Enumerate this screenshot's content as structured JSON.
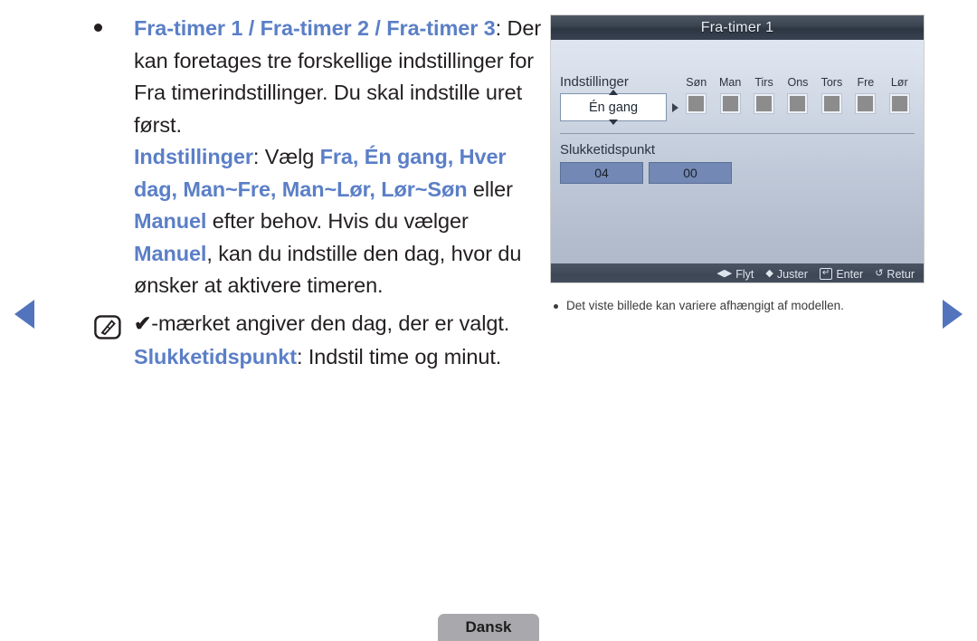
{
  "document": {
    "language_tab": "Dansk"
  },
  "navigation": {
    "prev_label": "previous-page",
    "next_label": "next-page"
  },
  "content": {
    "bullet_paragraph": {
      "term": "Fra-timer 1 / Fra-timer 2 / Fra-timer 3",
      "term_plain_tail": "3",
      "description": ": Der kan foretages tre forskellige indstillinger for Fra timerindstillinger. Du skal indstille uret først."
    },
    "settings_paragraph": {
      "label": "Indstillinger",
      "lead": ": Vælg ",
      "options": "Fra, Én gang, Hver dag, Man~Fre, Man~Lør, Lør~Søn",
      "mid": " eller ",
      "manual": "Manuel",
      "tail": " efter behov. Hvis du vælger ",
      "manual2": "Manuel",
      "tail2": ", kan du indstille den dag, hvor du ønsker at aktivere timeren."
    },
    "note": {
      "icon": "note-pen-icon",
      "check": "✔",
      "text": "-mærket angiver den dag, der er valgt."
    },
    "offtime_paragraph": {
      "label": "Slukketidspunkt",
      "text": ": Indstil time og minut."
    }
  },
  "tv_screen": {
    "title": "Fra-timer 1",
    "settings_label": "Indstillinger",
    "settings_value": "Én gang",
    "days": [
      {
        "name": "Søn",
        "checked": false
      },
      {
        "name": "Man",
        "checked": false
      },
      {
        "name": "Tirs",
        "checked": false
      },
      {
        "name": "Ons",
        "checked": false
      },
      {
        "name": "Tors",
        "checked": false
      },
      {
        "name": "Fre",
        "checked": false
      },
      {
        "name": "Lør",
        "checked": false
      }
    ],
    "offtime_label": "Slukketidspunkt",
    "hour_value": "04",
    "minute_value": "00",
    "status_bar": [
      {
        "glyph": "◀▶",
        "label": "Flyt",
        "icon": "left-right-arrows-icon"
      },
      {
        "glyph": "◆",
        "label": "Juster",
        "icon": "up-down-arrows-icon"
      },
      {
        "glyph": "↵",
        "label": "Enter",
        "icon": "enter-key-icon"
      },
      {
        "glyph": "↺",
        "label": "Retur",
        "icon": "return-arrow-icon"
      }
    ]
  },
  "tv_caption": {
    "text": "Det viste billede kan variere afhængigt af modellen."
  },
  "colors": {
    "accent_blue": "#5b7fc7",
    "nav_arrow": "#5274bd",
    "time_field": "#7388b4",
    "footer_tab": "#a9a9ad"
  }
}
